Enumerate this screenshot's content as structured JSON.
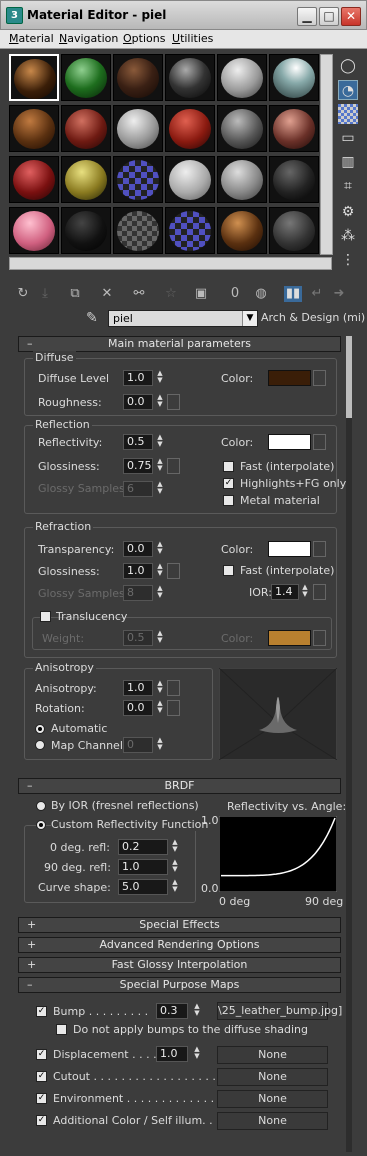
{
  "window": {
    "title": "Material Editor - piel",
    "app_icon": "3ds-max-icon",
    "minimize": "minimize-icon",
    "maximize": "maximize-icon",
    "close": "close-icon"
  },
  "menu": {
    "items": [
      "Material",
      "Navigation",
      "Options",
      "Utilities"
    ]
  },
  "toolbar": {
    "material_name": "piel",
    "material_type": "Arch & Design (mi)",
    "mat_id": "0"
  },
  "colors": {
    "diffuse": "#3a1e08",
    "reflection": "#ffffff",
    "refraction": "#ffffff",
    "translucency": "#b9802f"
  },
  "main": {
    "title": "Main material parameters",
    "diffuse": {
      "group": "Diffuse",
      "level_label": "Diffuse Level",
      "level": "1.0",
      "roughness_label": "Roughness:",
      "roughness": "0.0",
      "color_label": "Color:"
    },
    "reflection": {
      "group": "Reflection",
      "reflectivity_label": "Reflectivity:",
      "reflectivity": "0.5",
      "glossiness_label": "Glossiness:",
      "glossiness": "0.75",
      "samples_label": "Glossy Samples",
      "samples": "6",
      "color_label": "Color:",
      "fast_label": "Fast (interpolate)",
      "highlights_label": "Highlights+FG only",
      "metal_label": "Metal material"
    },
    "refraction": {
      "group": "Refraction",
      "transparency_label": "Transparency:",
      "transparency": "0.0",
      "glossiness_label": "Glossiness:",
      "glossiness": "1.0",
      "samples_label": "Glossy Samples",
      "samples": "8",
      "color_label": "Color:",
      "fast_label": "Fast (interpolate)",
      "ior_label": "IOR:",
      "ior": "1.4",
      "translucency_label": "Translucency",
      "weight_label": "Weight:",
      "weight": "0.5",
      "tcolor_label": "Color:"
    },
    "anisotropy": {
      "group": "Anisotropy",
      "anisotropy_label": "Anisotropy:",
      "anisotropy": "1.0",
      "rotation_label": "Rotation:",
      "rotation": "0.0",
      "automatic_label": "Automatic",
      "map_channel_label": "Map Channel:",
      "map_channel": "0"
    }
  },
  "brdf": {
    "title": "BRDF",
    "by_ior_label": "By IOR (fresnel reflections)",
    "custom_label": "Custom Reflectivity Function",
    "deg0_label": "0 deg. refl:",
    "deg0": "0.2",
    "deg90_label": "90 deg. refl:",
    "deg90": "1.0",
    "curve_label": "Curve shape:",
    "curve": "5.0",
    "graph_title": "Reflectivity vs. Angle:",
    "y_max": "1.0",
    "y_min": "0.0",
    "x_min": "0 deg",
    "x_max": "90 deg"
  },
  "rollouts": {
    "special_effects": "Special Effects",
    "advanced": "Advanced Rendering Options",
    "fast_glossy": "Fast Glossy Interpolation",
    "special_maps": "Special Purpose Maps"
  },
  "maps": {
    "bump_label": "Bump . . . . . . . . .",
    "bump": "0.3",
    "bump_map": "\\25_leather_bump.jpg]",
    "no_diffuse_label": "Do not apply bumps to the diffuse shading",
    "displacement_label": "Displacement . . . .",
    "displacement": "1.0",
    "displacement_map": "None",
    "cutout_label": "Cutout . . . . . . . . . . . . . . . . . . . .",
    "cutout_map": "None",
    "environment_label": "Environment . . . . . . . . . . . . . . . . .",
    "environment_map": "None",
    "additional_label": "Additional Color / Self illum. . . .",
    "additional_map": "None"
  }
}
